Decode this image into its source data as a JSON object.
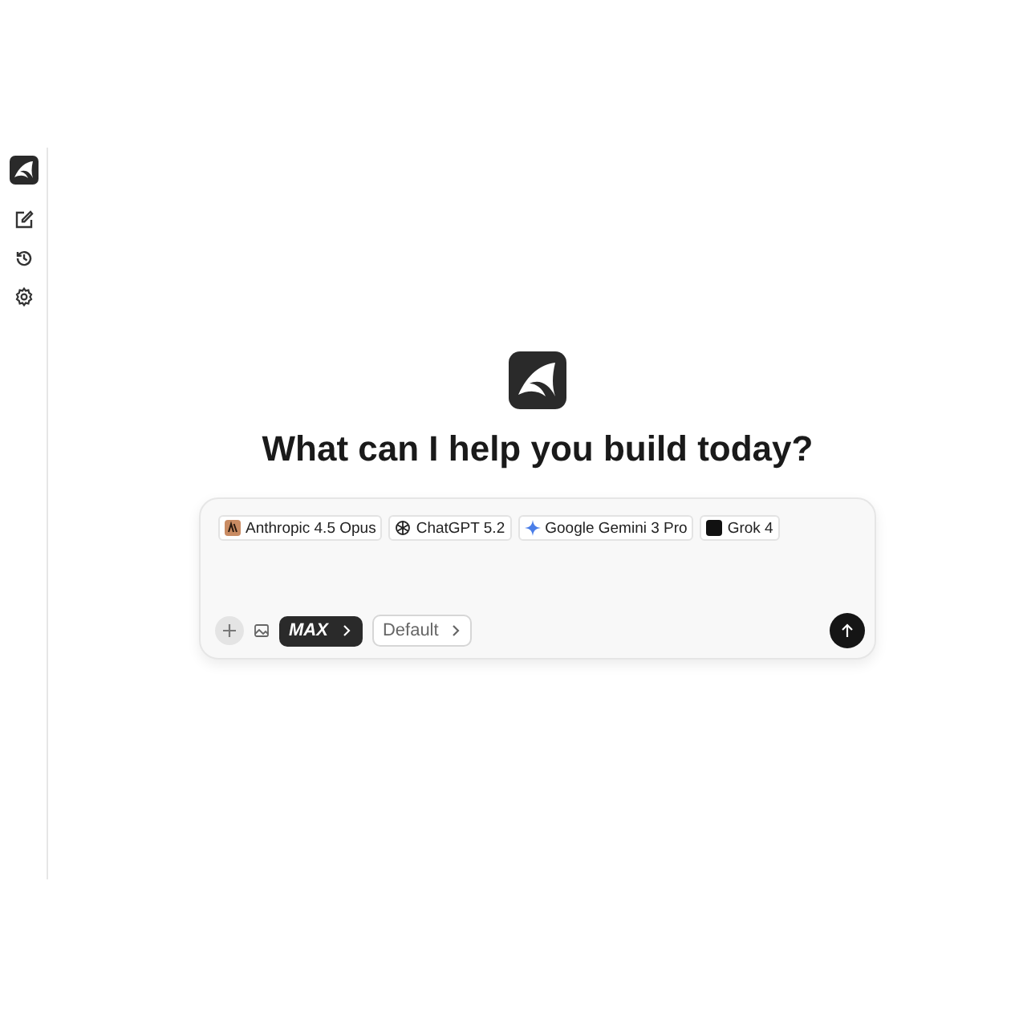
{
  "heading": "What can I help you build today?",
  "models": [
    {
      "label": "Anthropic 4.5 Opus",
      "kind": "anthropic"
    },
    {
      "label": "ChatGPT 5.2",
      "kind": "openai"
    },
    {
      "label": "Google Gemini 3 Pro",
      "kind": "gemini"
    },
    {
      "label": "Grok 4",
      "kind": "grok"
    }
  ],
  "mode_button": {
    "label": "MAX"
  },
  "preset_button": {
    "label": "Default"
  }
}
